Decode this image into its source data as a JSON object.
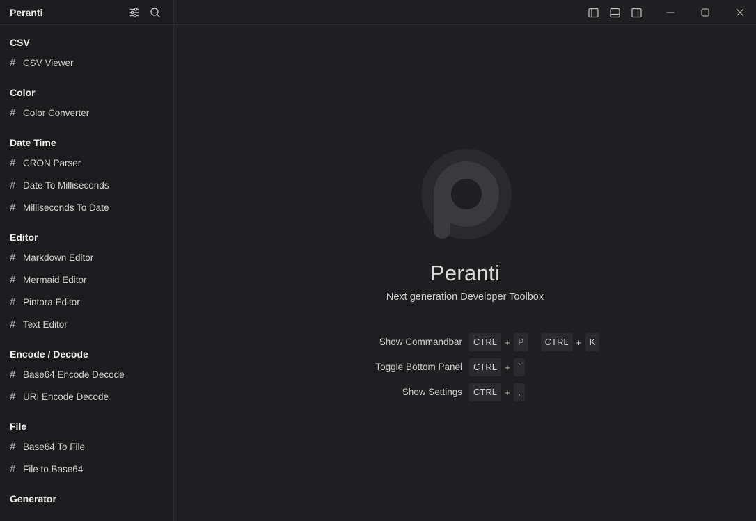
{
  "app": {
    "name": "Peranti"
  },
  "sidebar": {
    "groups": [
      {
        "title": "CSV",
        "items": [
          "CSV Viewer"
        ]
      },
      {
        "title": "Color",
        "items": [
          "Color Converter"
        ]
      },
      {
        "title": "Date Time",
        "items": [
          "CRON Parser",
          "Date To Milliseconds",
          "Milliseconds To Date"
        ]
      },
      {
        "title": "Editor",
        "items": [
          "Markdown Editor",
          "Mermaid Editor",
          "Pintora Editor",
          "Text Editor"
        ]
      },
      {
        "title": "Encode / Decode",
        "items": [
          "Base64 Encode Decode",
          "URI Encode Decode"
        ]
      },
      {
        "title": "File",
        "items": [
          "Base64 To File",
          "File to Base64"
        ]
      },
      {
        "title": "Generator",
        "items": []
      }
    ],
    "item_icon": "#"
  },
  "welcome": {
    "title": "Peranti",
    "subtitle": "Next generation Developer Toolbox",
    "shortcuts": [
      {
        "label": "Show Commandbar",
        "combos": [
          [
            "CTRL",
            "P"
          ],
          [
            "CTRL",
            "K"
          ]
        ]
      },
      {
        "label": "Toggle Bottom Panel",
        "combos": [
          [
            "CTRL",
            "`"
          ]
        ]
      },
      {
        "label": "Show Settings",
        "combos": [
          [
            "CTRL",
            ","
          ]
        ]
      }
    ],
    "plus": "+"
  },
  "icons": {
    "header": [
      "sliders-icon",
      "search-icon"
    ],
    "topbar": [
      "toggle-left-panel-icon",
      "toggle-bottom-panel-icon",
      "toggle-right-panel-icon",
      "minimize-icon",
      "maximize-icon",
      "close-icon"
    ]
  },
  "colors": {
    "background": "#1f1f22",
    "sidebar": "#1c1c1f",
    "key_bg": "#2b2b2f",
    "logo": "#333337"
  }
}
